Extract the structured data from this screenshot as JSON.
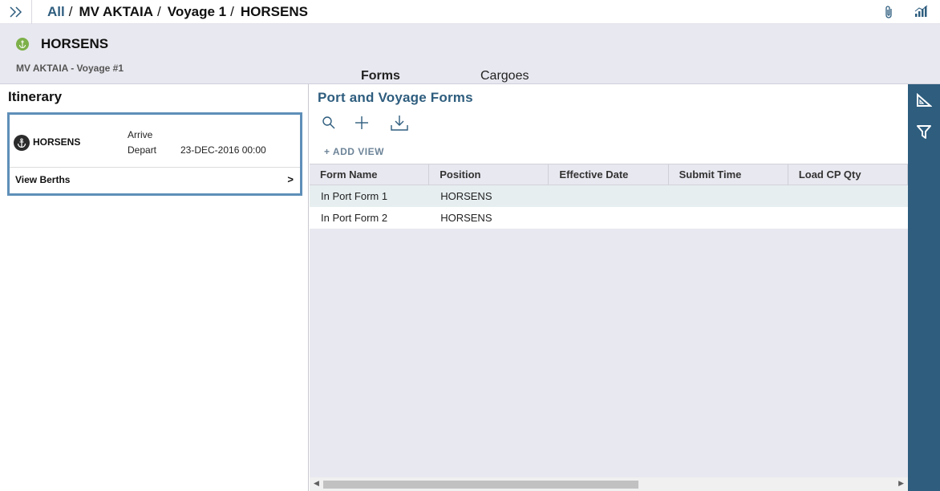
{
  "breadcrumb": {
    "all": "All",
    "sep": "/",
    "vessel": "MV AKTAIA",
    "voyage": "Voyage 1",
    "port": "HORSENS"
  },
  "header": {
    "title": "HORSENS",
    "subtitle": "MV AKTAIA - Voyage #1",
    "tabs": [
      {
        "label": "Forms",
        "active": true
      },
      {
        "label": "Cargoes",
        "active": false
      }
    ]
  },
  "itinerary": {
    "title": "Itinerary",
    "card": {
      "port": "HORSENS",
      "arrive_label": "Arrive",
      "arrive_value": "",
      "depart_label": "Depart",
      "depart_value": "23-DEC-2016 00:00",
      "view_berths": "View Berths",
      "chevron": ">"
    }
  },
  "forms": {
    "title": "Port and Voyage Forms",
    "add_view": "+ ADD VIEW",
    "columns": [
      "Form Name",
      "Position",
      "Effective Date",
      "Submit Time",
      "Load CP Qty"
    ],
    "rows": [
      [
        "In Port Form 1",
        "HORSENS",
        "",
        "",
        ""
      ],
      [
        "In Port Form 2",
        "HORSENS",
        "",
        "",
        ""
      ]
    ]
  },
  "icons": {
    "expand": "double-chevron-right-icon",
    "attach": "paperclip-icon",
    "signal": "signal-bars-icon",
    "search": "search-icon",
    "add": "plus-icon",
    "download": "download-icon",
    "ruler": "set-square-icon",
    "filter": "filter-icon",
    "anchor": "anchor-icon"
  },
  "colors": {
    "accent": "#2e5d7e",
    "header_bg": "#e8e8f0",
    "card_border": "#5e8fb8",
    "port_badge": "#7db049",
    "row_highlight": "#e6eef0"
  }
}
